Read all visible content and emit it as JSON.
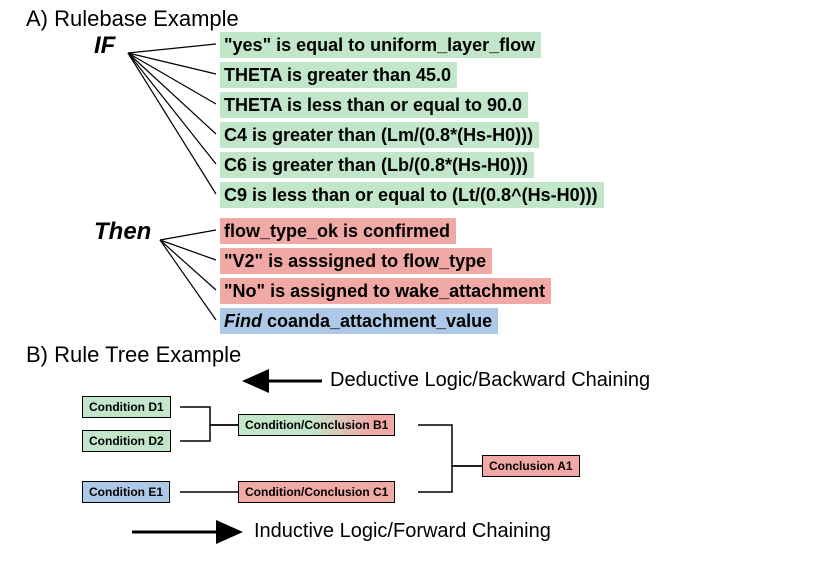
{
  "sectionA": {
    "title": "A) Rulebase Example",
    "if_label": "IF",
    "then_label": "Then",
    "conditions": [
      "\"yes\" is equal to uniform_layer_flow",
      "THETA is greater than 45.0",
      "THETA is less than or equal to 90.0",
      "C4 is greater than (Lm/(0.8*(Hs-H0)))",
      "C6 is greater than (Lb/(0.8*(Hs-H0)))",
      "C9 is less than or equal to (Lt/(0.8^(Hs-H0)))"
    ],
    "conclusions": [
      "flow_type_ok is confirmed",
      "\"V2\" is asssigned to flow_type",
      "\"No\" is assigned to wake_attachment"
    ],
    "subgoal_prefix": "Find",
    "subgoal_value": " coanda_attachment_value"
  },
  "sectionB": {
    "title": "B) Rule Tree Example",
    "nodes": {
      "d1": "Condition D1",
      "d2": "Condition D2",
      "e1": "Condition E1",
      "b1": "Condition/Conclusion B1",
      "c1": "Condition/Conclusion C1",
      "a1": "Conclusion A1"
    },
    "deductive_caption": "Deductive Logic/Backward Chaining",
    "inductive_caption": "Inductive Logic/Forward Chaining"
  }
}
